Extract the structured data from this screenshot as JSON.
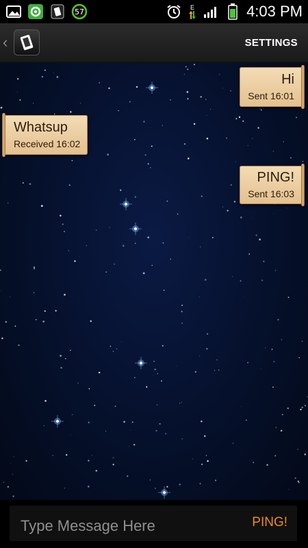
{
  "status_bar": {
    "time": "4:03 PM",
    "notification_badge": "57",
    "network_type": "E"
  },
  "action_bar": {
    "settings_label": "SETTINGS"
  },
  "messages": [
    {
      "text": "Hi",
      "meta": "Sent 16:01",
      "direction": "outgoing"
    },
    {
      "text": "Whatsup",
      "meta": "Received 16:02",
      "direction": "incoming"
    },
    {
      "text": "PING!",
      "meta": "Sent 16:03",
      "direction": "outgoing"
    }
  ],
  "composer": {
    "placeholder": "Type Message Here",
    "send_label": "PING!"
  },
  "colors": {
    "accent": "#f08a1e",
    "bubble": "#ecd0a3",
    "background": "#05102b"
  }
}
